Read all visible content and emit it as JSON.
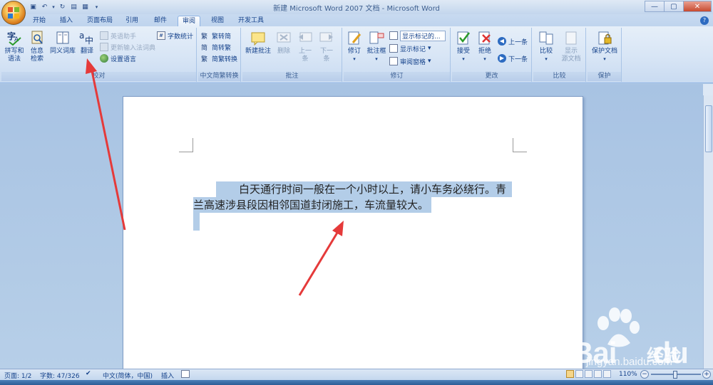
{
  "window": {
    "title": "新建 Microsoft Word 2007 文档 - Microsoft Word"
  },
  "tabs": [
    {
      "label": "开始"
    },
    {
      "label": "插入"
    },
    {
      "label": "页面布局"
    },
    {
      "label": "引用"
    },
    {
      "label": "邮件"
    },
    {
      "label": "审阅",
      "active": true
    },
    {
      "label": "视图"
    },
    {
      "label": "开发工具"
    }
  ],
  "ribbon": {
    "proofing": {
      "name": "校对",
      "spelling": "拼写和\n语法",
      "research": "信息\n检索",
      "thesaurus": "同义词库",
      "translate": "翻译",
      "translate_tip": "英语助手",
      "update_ime": "更新输入法词典",
      "set_language": "设置语言",
      "word_count": "字数统计"
    },
    "chinese": {
      "name": "中文简繁转换",
      "to_simplified": "繁转简",
      "to_traditional": "简转繁",
      "convert": "简繁转换"
    },
    "comments": {
      "name": "批注",
      "new": "新建批注",
      "delete": "删除",
      "prev": "上一\n条",
      "next": "下一\n条"
    },
    "tracking": {
      "name": "修订",
      "track": "修订",
      "balloons": "批注框",
      "display_select": "显示标记的...",
      "show_markup": "显示标记",
      "review_pane": "审阅窗格"
    },
    "changes": {
      "name": "更改",
      "accept": "接受",
      "reject": "拒绝",
      "previous": "上一条",
      "next": "下一条"
    },
    "compare": {
      "name": "比较",
      "compare": "比较",
      "show_source": "显示\n源文档"
    },
    "protect": {
      "name": "保护",
      "protect_doc": "保护文档"
    }
  },
  "document": {
    "line1": "白天通行时间一般在一个小时以上，请小车务必绕行。青",
    "line2": "兰高速涉县段因相邻国道封闭施工，车流量较大。"
  },
  "status": {
    "page": "页面: 1/2",
    "words": "字数: 47/326",
    "language": "中文(简体，中国)",
    "insert": "插入",
    "zoom": "110%"
  },
  "watermark": {
    "brand": "Bai",
    "brand2": "du",
    "cn": "经验",
    "url": "jingyan.baidu.com"
  },
  "colors": {
    "selection": "#b3cde8",
    "annotation_arrow": "#e53a3a",
    "ribbon_text": "#15428b"
  }
}
